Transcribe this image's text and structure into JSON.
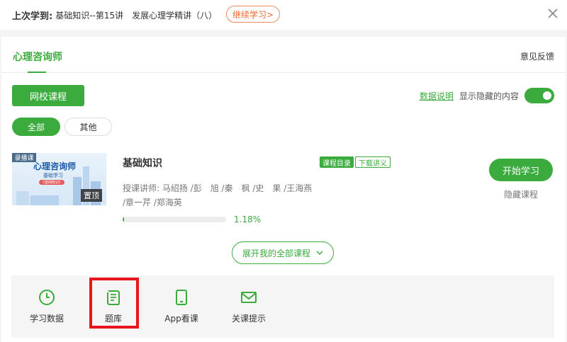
{
  "topbar": {
    "last_label": "上次学到:",
    "course_text": "基础知识--第15讲",
    "lesson_text": "发展心理学精讲（八）",
    "continue_label": "继续学习>",
    "close_icon": "close-icon"
  },
  "card": {
    "title": "心理咨询师",
    "feedback_label": "意见反馈",
    "school_button": "网校课程",
    "data_link": "数据说明",
    "show_hidden_label": "显示隐藏的内容",
    "show_hidden_on": true,
    "filters": [
      "全部",
      "其他"
    ]
  },
  "course": {
    "thumb": {
      "tag": "录播课",
      "title": "心理咨询师",
      "subtitle": "基础学习",
      "pill": "《基础知识》",
      "pin_label": "置顶"
    },
    "title": "基础知识",
    "catalog_badge": "课程目录",
    "download_badge": "下载讲义",
    "teachers_line1": "授课讲师:  马绍扬 /彭　旭 /秦　枫 /史　果 /王海燕",
    "teachers_line2": "/章一芹 /郑海英",
    "progress_pct_text": "1.18%",
    "progress_value": 1.18,
    "start_button": "开始学习",
    "hide_link": "隐藏课程"
  },
  "expand_button": "展开我的全部课程",
  "tools": [
    {
      "label": "学习数据",
      "icon": "clock-icon"
    },
    {
      "label": "题库",
      "icon": "document-icon"
    },
    {
      "label": "App看课",
      "icon": "tablet-icon"
    },
    {
      "label": "关课提示",
      "icon": "mail-icon"
    }
  ],
  "colors": {
    "primary_green": "#3aab3c",
    "accent_orange": "#f06a30",
    "highlight_red": "#e8141e"
  }
}
